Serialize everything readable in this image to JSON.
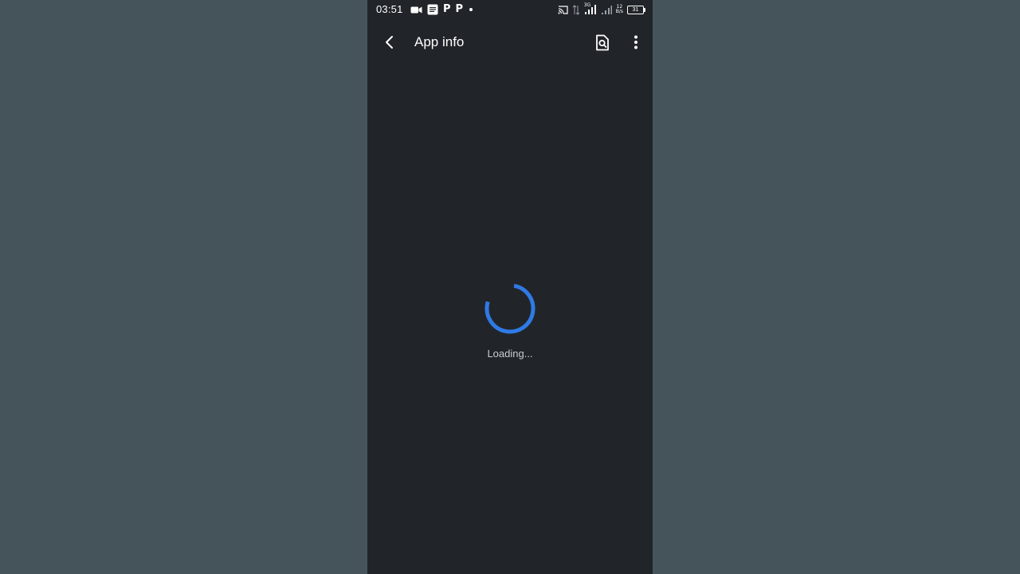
{
  "status_bar": {
    "time": "03:51",
    "network_type": "3G",
    "speed_value": "12",
    "speed_unit": "B/s",
    "battery_level": "31",
    "left_icons": [
      "video-camera-icon",
      "message-icon",
      "p-app-icon",
      "p-app-icon",
      "dot-icon"
    ],
    "right_icons": [
      "cast-icon",
      "signal-icon",
      "signal-3g-icon",
      "signal-icon",
      "speed-indicator",
      "battery-icon"
    ]
  },
  "app_bar": {
    "title": "App info",
    "back_icon": "back-arrow-icon",
    "search_icon": "search-document-icon",
    "more_icon": "more-vertical-icon"
  },
  "content": {
    "loading_text": "Loading...",
    "spinner_icon": "loading-spinner-icon"
  },
  "colors": {
    "background": "#212529",
    "backdrop": "#44545a",
    "accent": "#2f7ae5",
    "text_primary": "#ffffff",
    "text_secondary": "#c9ccd0"
  }
}
